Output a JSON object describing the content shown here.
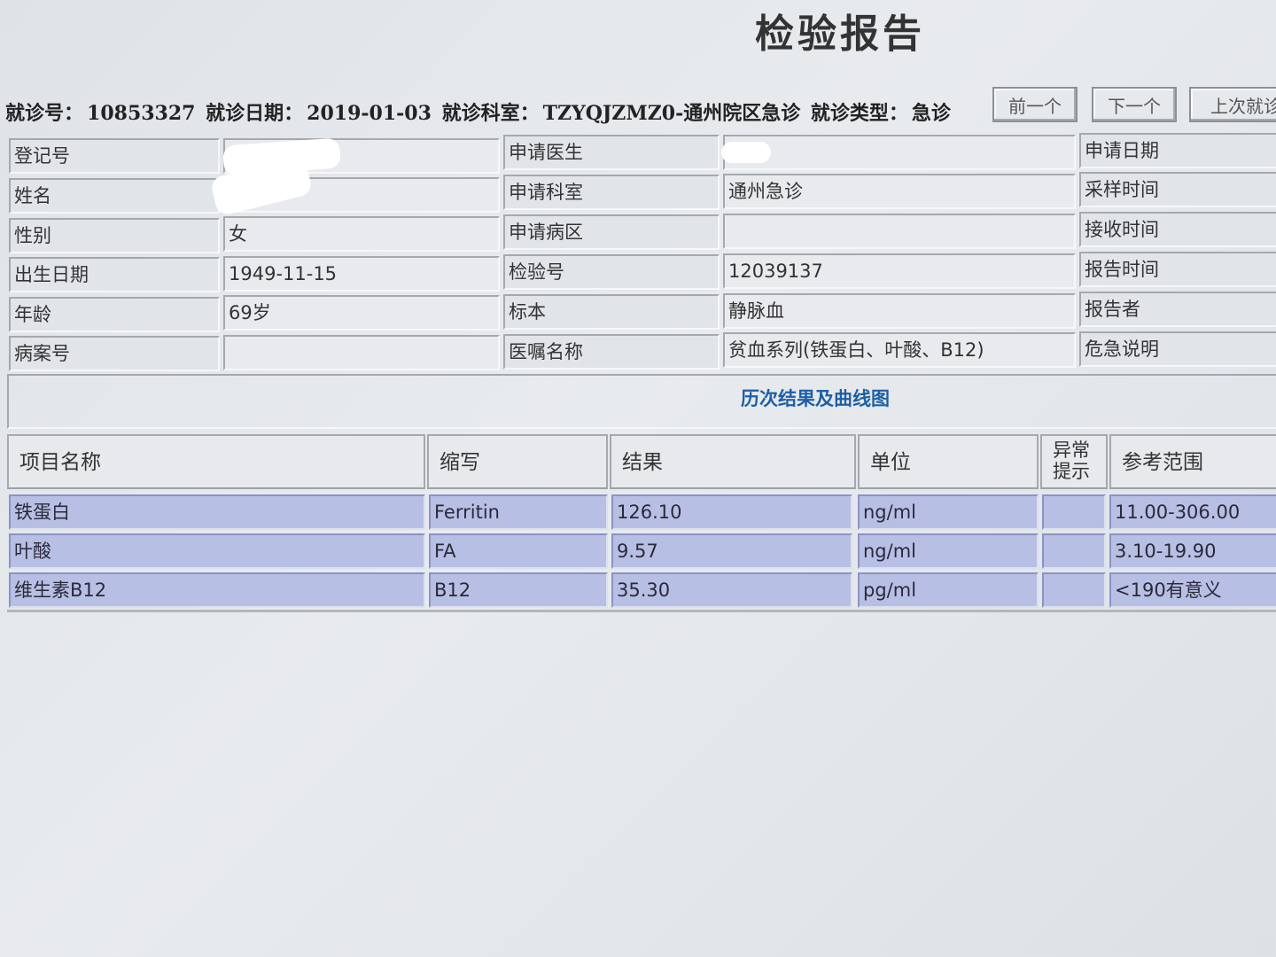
{
  "title": "检验报告",
  "visit": {
    "visit_no_label": "就诊号：",
    "visit_no": "10853327",
    "visit_date_label": "就诊日期：",
    "visit_date": "2019-01-03",
    "department_label": "就诊科室：",
    "department": "TZYQJZMZ0-通州院区急诊",
    "visit_type_label": "就诊类型：",
    "visit_type": "急诊"
  },
  "buttons": {
    "prev": "前一个",
    "next": "下一个",
    "last": "上次就诊"
  },
  "info": {
    "reg_no_label": "登记号",
    "name_label": "姓名",
    "sex_label": "性别",
    "sex": "女",
    "dob_label": "出生日期",
    "dob": "1949-11-15",
    "age_label": "年龄",
    "age": "69岁",
    "case_no_label": "病案号",
    "doctor_label": "申请医生",
    "dept_label": "申请科室",
    "dept": "通州急诊",
    "ward_label": "申请病区",
    "test_no_label": "检验号",
    "test_no": "12039137",
    "specimen_label": "标本",
    "specimen": "静脉血",
    "order_label": "医嘱名称",
    "order": "贫血系列(铁蛋白、叶酸、B12)",
    "apply_date_label": "申请日期",
    "sample_time_label": "采样时间",
    "receive_time_label": "接收时间",
    "report_time_label": "报告时间",
    "reporter_label": "报告者",
    "critical_label": "危急说明"
  },
  "history_link": "历次结果及曲线图",
  "results": {
    "headers": {
      "name": "项目名称",
      "abbr": "缩写",
      "result": "结果",
      "unit": "单位",
      "flag_line1": "异常",
      "flag_line2": "提示",
      "range": "参考范围"
    },
    "rows": [
      {
        "name": "铁蛋白",
        "abbr": "Ferritin",
        "result": "126.10",
        "unit": "ng/ml",
        "flag": "",
        "range": "11.00-306.00"
      },
      {
        "name": "叶酸",
        "abbr": "FA",
        "result": "9.57",
        "unit": "ng/ml",
        "flag": "",
        "range": "3.10-19.90"
      },
      {
        "name": "维生素B12",
        "abbr": "B12",
        "result": "35.30",
        "unit": "pg/ml",
        "flag": "",
        "range": "<190有意义"
      }
    ]
  }
}
